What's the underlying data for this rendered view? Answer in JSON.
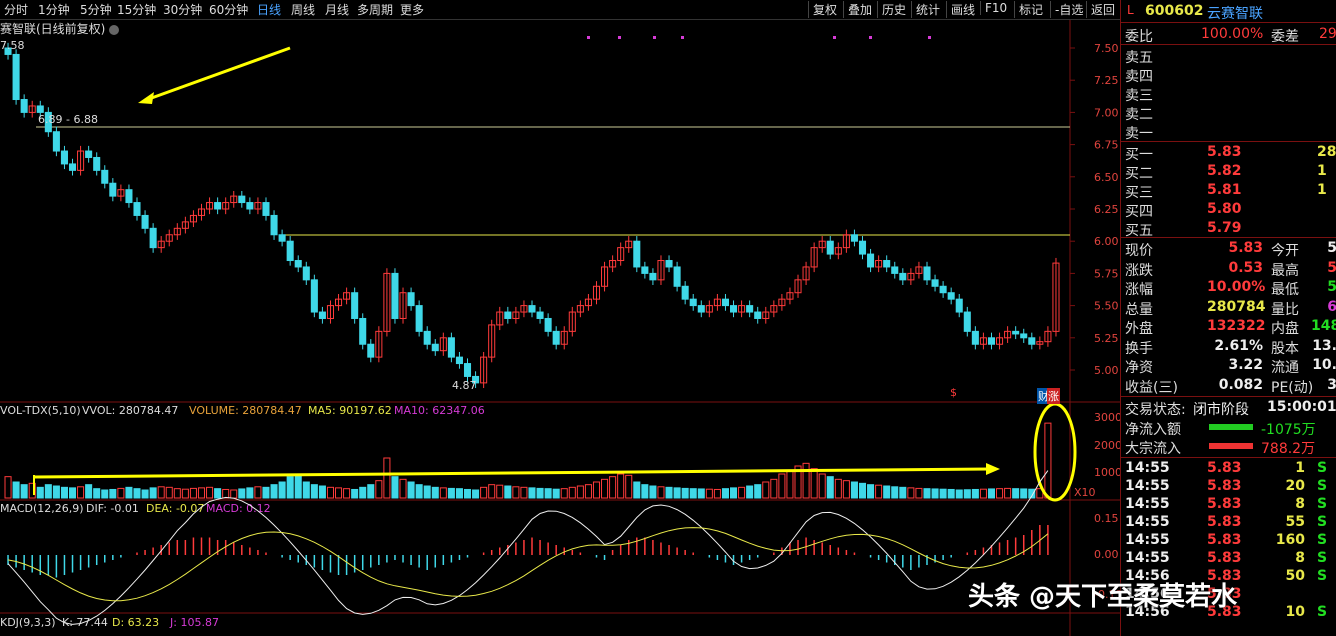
{
  "tabs": [
    "分时",
    "1分钟",
    "5分钟",
    "15分钟",
    "30分钟",
    "60分钟",
    "日线",
    "周线",
    "月线",
    "多周期",
    "更多"
  ],
  "active_tab": "日线",
  "toolbar": [
    "复权",
    "叠加",
    "历史",
    "统计",
    "画线",
    "F10",
    "标记",
    "-自选",
    "返回"
  ],
  "title": "赛智联(日线前复权)",
  "price_axis": [
    "7.50",
    "7.25",
    "7.00",
    "6.75",
    "6.50",
    "6.25",
    "6.00",
    "5.75",
    "5.50",
    "5.25",
    "5.00"
  ],
  "price_labels": {
    "top": "7.58",
    "range": "6.89 - 6.88",
    "low": "4.87"
  },
  "vol_title": {
    "name": "VOL-TDX(5,10)",
    "vvol": "VVOL: 280784.47",
    "volume": "VOLUME: 280784.47",
    "ma5": "MA5: 90197.62",
    "ma10": "MA10: 62347.06"
  },
  "vol_axis": [
    "30000",
    "20000",
    "10000"
  ],
  "vol_unit": "X10",
  "macd_title": {
    "name": "MACD(12,26,9)",
    "dif": "DIF: -0.01",
    "dea": "DEA: -0.07",
    "macd": "MACD: 0.12"
  },
  "macd_axis": [
    "0.15",
    "0.00",
    "-0.15"
  ],
  "kdj_title": {
    "name": "KDJ(9,3,3)",
    "k": "K: 77.44",
    "d": "D: 63.23",
    "j": "J: 105.87"
  },
  "tags": {
    "cai": "财",
    "zhang": "涨",
    "dollar": "$"
  },
  "stock": {
    "prefix": "L",
    "code": "600602",
    "name": "云赛智联"
  },
  "order_ratio": {
    "label1": "委比",
    "value1": "100.00%",
    "label2": "委差",
    "value2": "29"
  },
  "sells": [
    "卖五",
    "卖四",
    "卖三",
    "卖二",
    "卖一"
  ],
  "buys": [
    {
      "label": "买一",
      "price": "5.83",
      "vol": "28"
    },
    {
      "label": "买二",
      "price": "5.82",
      "vol": "1"
    },
    {
      "label": "买三",
      "price": "5.81",
      "vol": "1"
    },
    {
      "label": "买四",
      "price": "5.80",
      "vol": ""
    },
    {
      "label": "买五",
      "price": "5.79",
      "vol": ""
    }
  ],
  "quotes": [
    {
      "l1": "现价",
      "v1": "5.83",
      "l2": "今开",
      "v2": "5"
    },
    {
      "l1": "涨跌",
      "v1": "0.53",
      "l2": "最高",
      "v2": "5"
    },
    {
      "l1": "涨幅",
      "v1": "10.00%",
      "l2": "最低",
      "v2": "5"
    },
    {
      "l1": "总量",
      "v1": "280784",
      "l2": "量比",
      "v2": "6"
    },
    {
      "l1": "外盘",
      "v1": "132322",
      "l2": "内盘",
      "v2": "148"
    },
    {
      "l1": "换手",
      "v1": "2.61%",
      "l2": "股本",
      "v2": "13."
    },
    {
      "l1": "净资",
      "v1": "3.22",
      "l2": "流通",
      "v2": "10."
    },
    {
      "l1": "收益(三)",
      "v1": "0.082",
      "l2": "PE(动)",
      "v2": "3"
    }
  ],
  "trade_status": {
    "label": "交易状态:",
    "value": "闭市阶段",
    "time": "15:00:01"
  },
  "flow": [
    {
      "label": "净流入额",
      "value": "-1075万"
    },
    {
      "label": "大宗流入",
      "value": "788.2万"
    }
  ],
  "ticks": [
    {
      "time": "14:55",
      "price": "5.83",
      "vol": "1",
      "bs": "S"
    },
    {
      "time": "14:55",
      "price": "5.83",
      "vol": "20",
      "bs": "S"
    },
    {
      "time": "14:55",
      "price": "5.83",
      "vol": "8",
      "bs": "S"
    },
    {
      "time": "14:55",
      "price": "5.83",
      "vol": "55",
      "bs": "S"
    },
    {
      "time": "14:55",
      "price": "5.83",
      "vol": "160",
      "bs": "S"
    },
    {
      "time": "14:55",
      "price": "5.83",
      "vol": "8",
      "bs": "S"
    },
    {
      "time": "14:56",
      "price": "5.83",
      "vol": "50",
      "bs": "S"
    },
    {
      "time": "14:56",
      "price": "5.83",
      "vol": "",
      "bs": ""
    },
    {
      "time": "14:56",
      "price": "5.83",
      "vol": "10",
      "bs": "S"
    }
  ],
  "watermark": "头条 @天下至柔莫若水",
  "chart_data": {
    "type": "candlestick",
    "ylim": [
      4.87,
      7.58
    ],
    "annotations": [
      "7.58",
      "6.89 - 6.88",
      "4.87"
    ],
    "closes": [
      7.45,
      7.1,
      7.0,
      7.05,
      7.0,
      6.85,
      6.7,
      6.6,
      6.55,
      6.7,
      6.65,
      6.55,
      6.45,
      6.35,
      6.4,
      6.3,
      6.2,
      6.1,
      5.95,
      6.0,
      6.05,
      6.1,
      6.15,
      6.2,
      6.25,
      6.3,
      6.25,
      6.3,
      6.35,
      6.3,
      6.25,
      6.3,
      6.2,
      6.05,
      6.0,
      5.85,
      5.8,
      5.7,
      5.45,
      5.4,
      5.5,
      5.55,
      5.6,
      5.4,
      5.2,
      5.1,
      5.3,
      5.75,
      5.4,
      5.6,
      5.5,
      5.3,
      5.2,
      5.15,
      5.25,
      5.1,
      5.05,
      4.95,
      4.9,
      5.1,
      5.35,
      5.45,
      5.4,
      5.45,
      5.5,
      5.45,
      5.4,
      5.3,
      5.2,
      5.3,
      5.45,
      5.5,
      5.55,
      5.65,
      5.8,
      5.85,
      5.95,
      6.0,
      5.8,
      5.75,
      5.7,
      5.85,
      5.8,
      5.65,
      5.55,
      5.5,
      5.45,
      5.5,
      5.55,
      5.5,
      5.45,
      5.5,
      5.45,
      5.4,
      5.45,
      5.5,
      5.55,
      5.6,
      5.7,
      5.8,
      5.95,
      6.0,
      5.9,
      5.95,
      6.05,
      6.0,
      5.9,
      5.8,
      5.85,
      5.8,
      5.75,
      5.7,
      5.75,
      5.8,
      5.7,
      5.65,
      5.6,
      5.55,
      5.45,
      5.3,
      5.2,
      5.25,
      5.2,
      5.25,
      5.3,
      5.28,
      5.25,
      5.2,
      5.22,
      5.3,
      5.83
    ],
    "volumes": [
      8000,
      6000,
      5000,
      5500,
      4000,
      5000,
      4500,
      4000,
      3800,
      4200,
      5000,
      3500,
      3000,
      3200,
      3600,
      4000,
      3500,
      3000,
      3800,
      4200,
      4000,
      3500,
      3300,
      3600,
      3800,
      4000,
      3500,
      3200,
      3000,
      3400,
      3800,
      4200,
      4000,
      5000,
      6000,
      8000,
      9000,
      6000,
      5000,
      4500,
      4000,
      3800,
      3500,
      3200,
      4000,
      5000,
      6500,
      15000,
      8000,
      7000,
      6000,
      5000,
      4500,
      4000,
      3800,
      3600,
      3500,
      3200,
      3000,
      4000,
      5000,
      4800,
      4500,
      4200,
      4000,
      3800,
      3600,
      3500,
      3300,
      3500,
      4000,
      4500,
      5000,
      6000,
      7000,
      8000,
      9000,
      8500,
      6000,
      5000,
      4500,
      4200,
      4000,
      3800,
      3600,
      3500,
      3400,
      3300,
      3200,
      3500,
      3800,
      4000,
      4500,
      5000,
      6000,
      7000,
      9000,
      10000,
      12000,
      13000,
      11000,
      9000,
      8000,
      7000,
      6500,
      6000,
      5500,
      5000,
      4800,
      4500,
      4200,
      4000,
      3800,
      3600,
      3500,
      3400,
      3300,
      3200,
      3000,
      3100,
      3200,
      3300,
      3400,
      3500,
      3600,
      3500,
      3400,
      3300,
      3500,
      28078
    ],
    "macd_hist": [
      -0.04,
      -0.05,
      -0.06,
      -0.07,
      -0.08,
      -0.08,
      -0.09,
      -0.08,
      -0.07,
      -0.06,
      -0.05,
      -0.04,
      -0.03,
      -0.02,
      -0.01,
      0.0,
      0.01,
      0.02,
      0.03,
      0.04,
      0.05,
      0.06,
      0.06,
      0.07,
      0.07,
      0.07,
      0.06,
      0.06,
      0.05,
      0.04,
      0.03,
      0.02,
      0.01,
      0.0,
      -0.01,
      -0.02,
      -0.03,
      -0.04,
      -0.05,
      -0.06,
      -0.07,
      -0.08,
      -0.08,
      -0.07,
      -0.06,
      -0.05,
      -0.04,
      -0.03,
      -0.02,
      -0.03,
      -0.04,
      -0.05,
      -0.06,
      -0.05,
      -0.04,
      -0.03,
      -0.02,
      -0.01,
      0.0,
      0.01,
      0.02,
      0.03,
      0.04,
      0.05,
      0.06,
      0.07,
      0.06,
      0.05,
      0.04,
      0.03,
      0.02,
      0.01,
      0.0,
      -0.01,
      -0.02,
      0.02,
      0.04,
      0.06,
      0.07,
      0.07,
      0.06,
      0.05,
      0.04,
      0.03,
      0.02,
      0.01,
      0.0,
      -0.01,
      -0.02,
      -0.03,
      -0.04,
      -0.03,
      -0.02,
      -0.01,
      0.0,
      0.01,
      0.03,
      0.05,
      0.06,
      0.07,
      0.06,
      0.05,
      0.04,
      0.03,
      0.02,
      0.01,
      0.0,
      -0.01,
      -0.02,
      -0.03,
      -0.04,
      -0.05,
      -0.06,
      -0.05,
      -0.04,
      -0.03,
      -0.02,
      -0.01,
      0.0,
      0.01,
      0.02,
      0.03,
      0.04,
      0.05,
      0.06,
      0.07,
      0.08,
      0.1,
      0.12,
      0.12
    ],
    "resistance_levels": [
      6.89,
      6.03
    ]
  }
}
